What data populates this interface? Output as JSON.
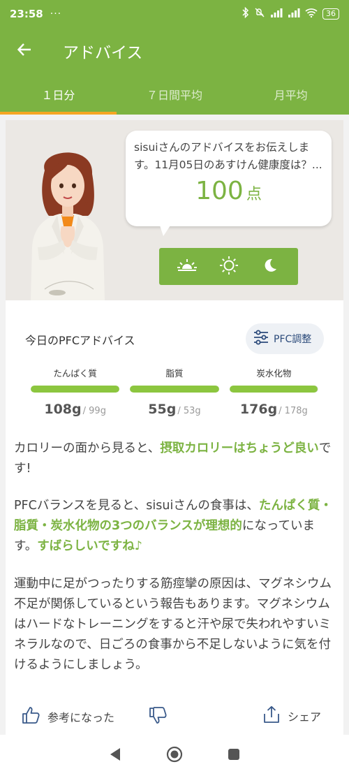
{
  "status_bar": {
    "time": "23:58",
    "dots": "···",
    "battery": "36"
  },
  "app_bar": {
    "title": "アドバイス"
  },
  "tabs": [
    {
      "label": "１日分",
      "active": true
    },
    {
      "label": "７日間平均",
      "active": false
    },
    {
      "label": "月平均",
      "active": false
    }
  ],
  "hero": {
    "message": "sisuiさんのアドバイスをお伝えします。11月05日のあすけん健康度は？...",
    "score": "100",
    "score_unit": "点"
  },
  "pfc": {
    "title": "今日のPFCアドバイス",
    "adjust_label": "PFC調整",
    "nutrients": [
      {
        "name": "たんぱく質",
        "value": "108",
        "unit": "g",
        "target": "/ 99g",
        "fill_pct": 100
      },
      {
        "name": "脂質",
        "value": "55",
        "unit": "g",
        "target": "/ 53g",
        "fill_pct": 100
      },
      {
        "name": "炭水化物",
        "value": "176",
        "unit": "g",
        "target": "/ 178g",
        "fill_pct": 99
      }
    ]
  },
  "advice": {
    "p1_a": "カロリーの面から見ると、",
    "p1_hl": "摂取カロリーはちょうど良い",
    "p1_b": "です!",
    "p2_a": "PFCバランスを見ると、sisuiさんの食事は、",
    "p2_hl1": "たんぱく質・脂質・炭水化物の3つのバランスが理想的",
    "p2_b": "になっています。",
    "p2_hl2": "すばらしいですね♪",
    "p3": "運動中に足がつったりする筋痙攣の原因は、マグネシウム不足が関係しているという報告もあります。マグネシウムはハードなトレーニングをすると汗や尿で失われやすいミネラルなので、日ごろの食事から不足しないように気を付けるようにしましょう。"
  },
  "actions": {
    "helpful_label": "参考になった",
    "share_label": "シェア"
  },
  "colors": {
    "brand_green": "#7cb342",
    "tab_indicator": "#f5a623",
    "bar_fill": "#8cc63f"
  }
}
